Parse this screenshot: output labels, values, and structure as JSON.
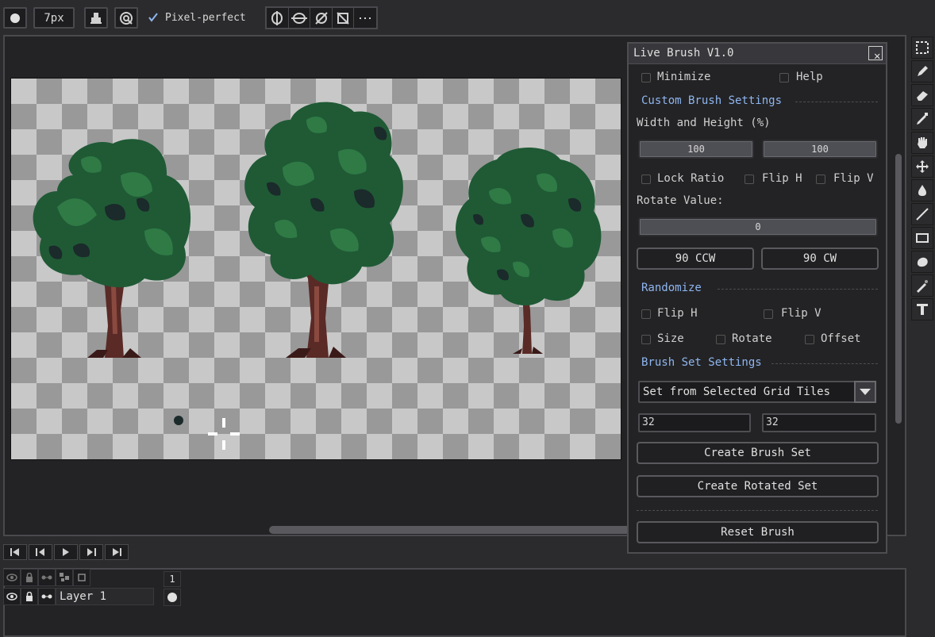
{
  "toolbar": {
    "brush_size": "7px",
    "pixel_perfect_label": "Pixel-perfect",
    "pixel_perfect_checked": true
  },
  "panel": {
    "title": "Live Brush V1.0",
    "minimize_label": "Minimize",
    "help_label": "Help",
    "custom_section": "Custom Brush Settings",
    "width_height_label": "Width and Height (%)",
    "width_value": "100",
    "height_value": "100",
    "lock_ratio_label": "Lock Ratio",
    "flip_h_label": "Flip H",
    "flip_v_label": "Flip V",
    "rotate_label": "Rotate Value:",
    "rotate_value": "0",
    "ccw_label": "90 CCW",
    "cw_label": "90 CW",
    "randomize_section": "Randomize",
    "rand_flip_h_label": "Flip H",
    "rand_flip_v_label": "Flip V",
    "rand_size_label": "Size",
    "rand_rotate_label": "Rotate",
    "rand_offset_label": "Offset",
    "brushset_section": "Brush Set Settings",
    "brushset_mode": "Set from Selected Grid Tiles",
    "grid_w": "32",
    "grid_h": "32",
    "create_set_label": "Create Brush Set",
    "create_rotated_label": "Create Rotated Set",
    "reset_label": "Reset Brush"
  },
  "layers": {
    "frame_number": "1",
    "layer_name": "Layer 1"
  },
  "colors": {
    "accent": "#8fb6f0",
    "leaf_dark": "#1b2a2a",
    "leaf_mid": "#1f5a35",
    "leaf_light": "#2f7a45",
    "trunk": "#5a2a26",
    "trunk_light": "#8a4a40"
  }
}
